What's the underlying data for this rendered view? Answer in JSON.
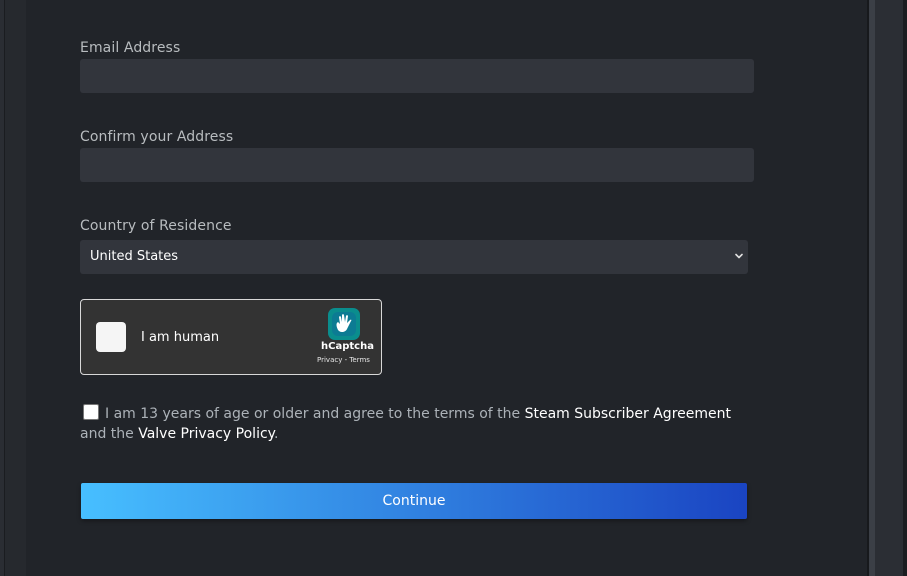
{
  "form": {
    "email_label": "Email Address",
    "email_value": "",
    "confirm_label": "Confirm your Address",
    "confirm_value": "",
    "country_label": "Country of Residence",
    "country_value": "United States"
  },
  "captcha": {
    "prompt": "I am human",
    "brand": "hCaptcha",
    "privacy_link": "Privacy",
    "separator": " - ",
    "terms_link": "Terms",
    "logo_icon": "hcaptcha-hand-icon"
  },
  "agreement": {
    "text_before": "I am 13 years of age or older and agree to the terms of the ",
    "subscriber_link": "Steam Subscriber Agreement",
    "text_middle": " and the ",
    "privacy_link": "Valve Privacy Policy",
    "text_after": "."
  },
  "actions": {
    "continue_label": "Continue"
  },
  "colors": {
    "panel_bg": "#212429",
    "input_bg": "#32353c",
    "button_gradient_start": "#47bfff",
    "button_gradient_end": "#1a44c2"
  }
}
